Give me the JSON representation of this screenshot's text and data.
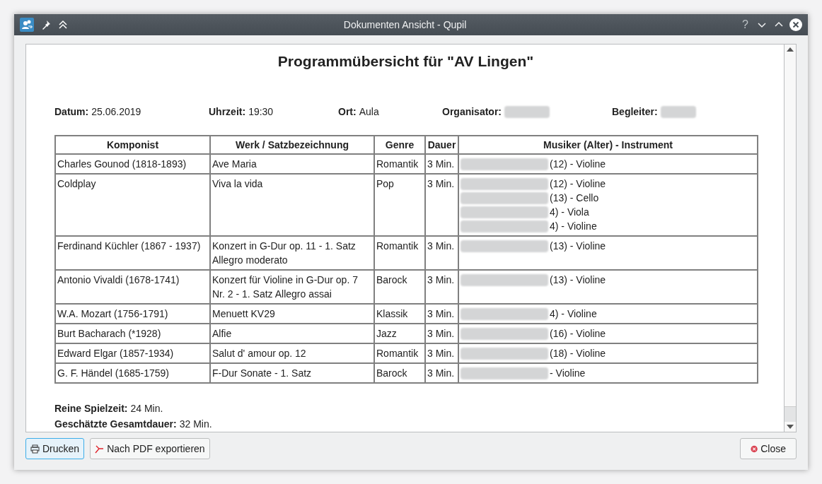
{
  "window": {
    "title": "Dokumenten Ansicht - Qupil",
    "buttons": [
      "?"
    ]
  },
  "document": {
    "title": "Programmübersicht für \"AV Lingen\"",
    "info": [
      {
        "label": "Datum:",
        "value": "25.06.2019",
        "redacted": false
      },
      {
        "label": "Uhrzeit:",
        "value": "19:30",
        "redacted": false
      },
      {
        "label": "Ort:",
        "value": "Aula",
        "redacted": false
      },
      {
        "label": "Organisator:",
        "redacted": true
      },
      {
        "label": "Begleiter:",
        "redacted": true
      }
    ],
    "table": {
      "columns": [
        "Komponist",
        "Werk / Satzbezeichnung",
        "Genre",
        "Dauer",
        "Musiker (Alter) - Instrument"
      ],
      "rows": [
        {
          "composer": "Charles Gounod (1818-1893)",
          "work": "Ave Maria",
          "genre": "Romantik",
          "duration": "3 Min.",
          "musicians": [
            {
              "redacted": true,
              "text": "(12) - Violine"
            }
          ]
        },
        {
          "composer": "Coldplay",
          "work": "Viva la vida",
          "genre": "Pop",
          "duration": "3 Min.",
          "musicians": [
            {
              "redacted": true,
              "text": "(12) - Violine"
            },
            {
              "redacted": true,
              "text": "(13) - Cello"
            },
            {
              "redacted": true,
              "text": "4) - Viola"
            },
            {
              "redacted": true,
              "text": "4) - Violine"
            }
          ]
        },
        {
          "composer": "Ferdinand Küchler (1867 - 1937)",
          "work": "Konzert in G-Dur op. 11 - 1. Satz Allegro moderato",
          "genre": "Romantik",
          "duration": "3 Min.",
          "musicians": [
            {
              "redacted": true,
              "text": "(13) - Violine"
            }
          ]
        },
        {
          "composer": "Antonio Vivaldi (1678-1741)",
          "work": "Konzert für Violine in G-Dur op. 7 Nr. 2 - 1. Satz Allegro assai",
          "genre": "Barock",
          "duration": "3 Min.",
          "musicians": [
            {
              "redacted": true,
              "text": "(13) - Violine"
            }
          ]
        },
        {
          "composer": "W.A. Mozart (1756-1791)",
          "work": "Menuett KV29",
          "genre": "Klassik",
          "duration": "3 Min.",
          "musicians": [
            {
              "redacted": true,
              "text": "4) - Violine"
            }
          ]
        },
        {
          "composer": "Burt Bacharach (*1928)",
          "work": "Alfie",
          "genre": "Jazz",
          "duration": "3 Min.",
          "musicians": [
            {
              "redacted": true,
              "text": "(16) - Violine"
            }
          ]
        },
        {
          "composer": "Edward Elgar (1857-1934)",
          "work": "Salut d' amour op. 12",
          "genre": "Romantik",
          "duration": "3 Min.",
          "musicians": [
            {
              "redacted": true,
              "text": "(18) - Violine"
            }
          ]
        },
        {
          "composer": "G. F. Händel (1685-1759)",
          "work": "F-Dur Sonate - 1. Satz",
          "genre": "Barock",
          "duration": "3 Min.",
          "musicians": [
            {
              "redacted": true,
              "text": "- Violine"
            }
          ]
        }
      ]
    },
    "summary": [
      {
        "label": "Reine Spielzeit:",
        "value": "24 Min."
      },
      {
        "label": "Geschätzte Gesamtdauer:",
        "value": "32 Min."
      }
    ]
  },
  "buttons": [
    {
      "kind": "print",
      "label": "Drucken",
      "focused": true
    },
    {
      "kind": "pdf",
      "label": "Nach PDF exportieren",
      "focused": false
    },
    {
      "kind": "close",
      "label": "Close",
      "focused": false
    }
  ]
}
